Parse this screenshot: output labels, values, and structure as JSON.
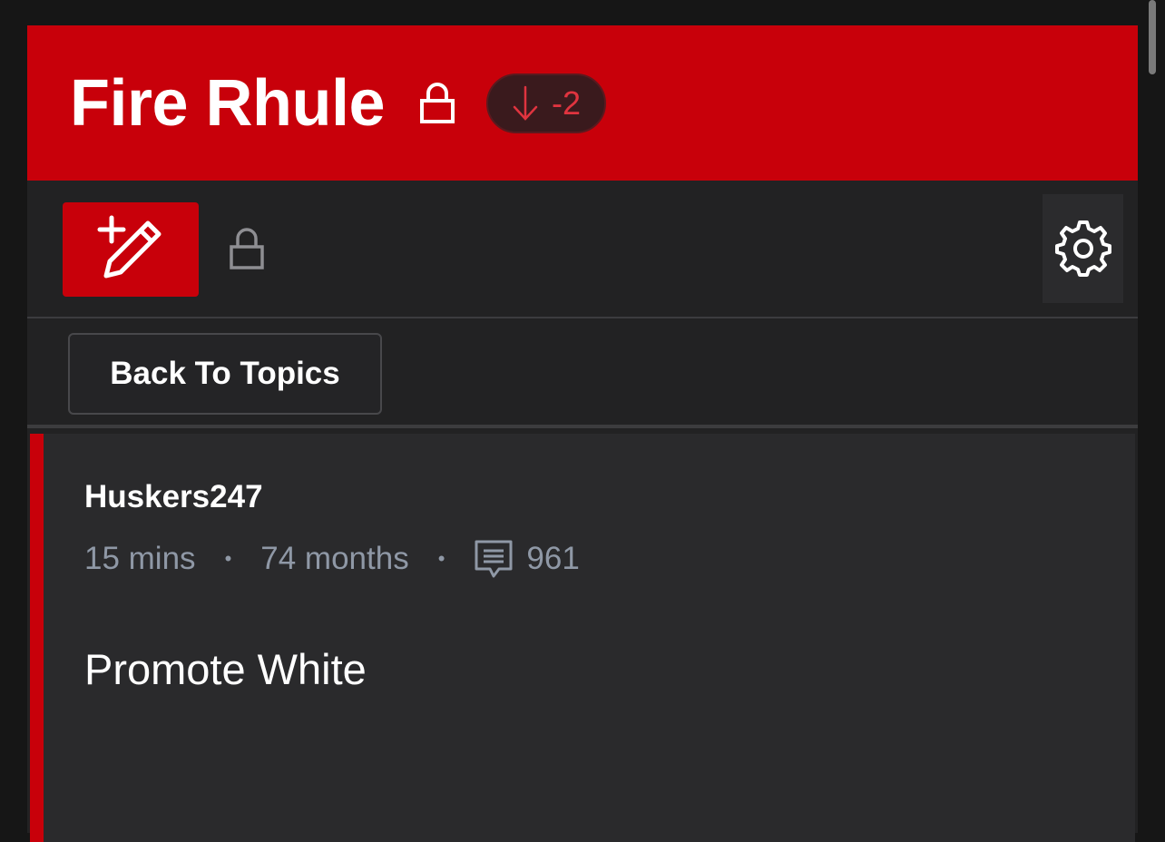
{
  "header": {
    "title": "Fire Rhule",
    "lock_icon": "lock-icon",
    "vote": {
      "icon": "arrow-down-icon",
      "value": "-2"
    }
  },
  "toolbar": {
    "new_post_icon": "pencil-plus-icon",
    "lock_icon": "lock-icon",
    "settings_icon": "gear-icon"
  },
  "nav": {
    "back_label": "Back To Topics"
  },
  "post": {
    "author": "Huskers247",
    "time": "15 mins",
    "separator": "•",
    "age": "74 months",
    "comment_icon": "comment-icon",
    "comment_count": "961",
    "body": "Promote White"
  },
  "colors": {
    "brand_red": "#c8000a",
    "background": "#161616",
    "panel": "#222223",
    "meta_gray": "#8f98a6",
    "vote_red": "#e0343f"
  }
}
